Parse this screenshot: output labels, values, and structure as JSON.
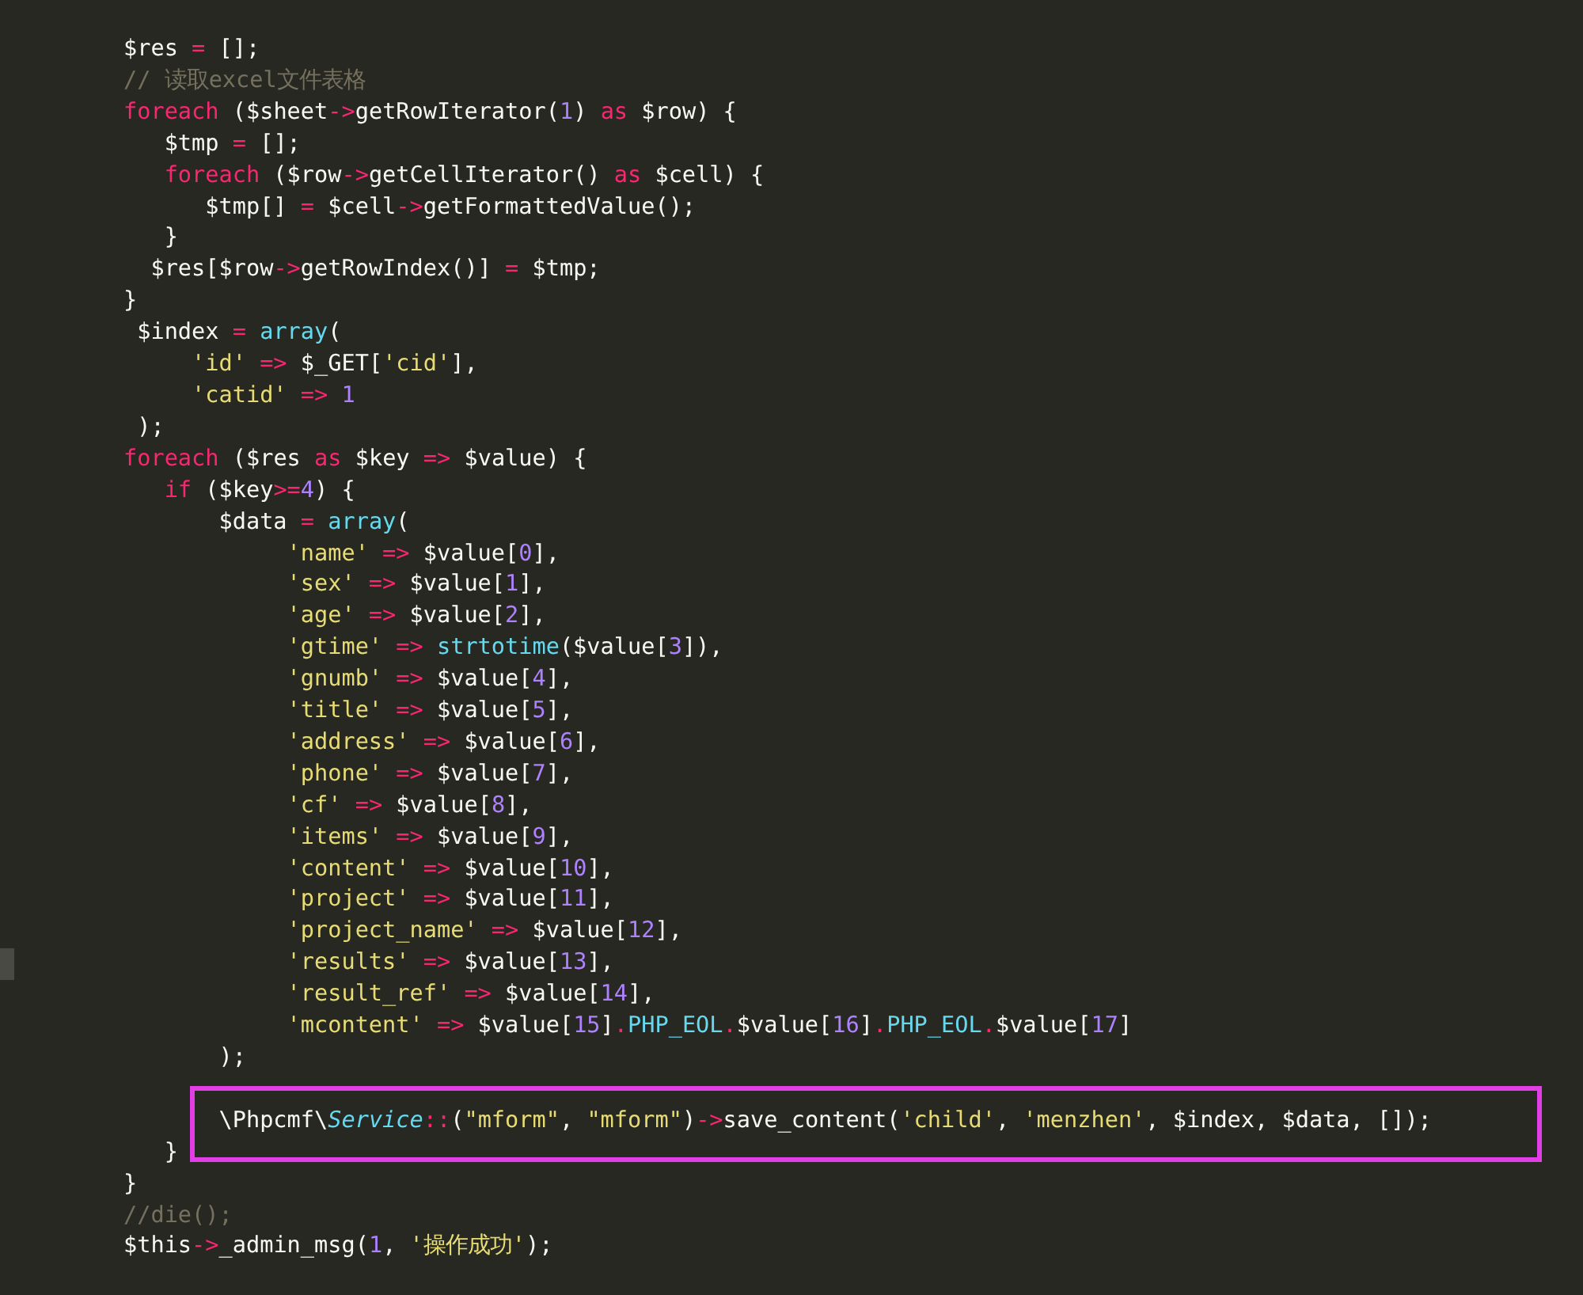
{
  "lines": [
    {
      "kind": "code",
      "tokens": [
        {
          "kind": "plain",
          "text": "$res "
        },
        {
          "kind": "keyword",
          "text": "="
        },
        {
          "kind": "plain",
          "text": " [];"
        }
      ]
    },
    {
      "kind": "code",
      "tokens": [
        {
          "kind": "comment",
          "text": "// 读取excel文件表格"
        }
      ]
    },
    {
      "kind": "code",
      "tokens": [
        {
          "kind": "keyword",
          "text": "foreach"
        },
        {
          "kind": "plain",
          "text": " ($sheet"
        },
        {
          "kind": "keyword",
          "text": "->"
        },
        {
          "kind": "plain",
          "text": "getRowIterator("
        },
        {
          "kind": "number",
          "text": "1"
        },
        {
          "kind": "plain",
          "text": ") "
        },
        {
          "kind": "keyword",
          "text": "as"
        },
        {
          "kind": "plain",
          "text": " $row) {"
        }
      ]
    },
    {
      "kind": "code",
      "tokens": [
        {
          "kind": "plain",
          "text": "   $tmp "
        },
        {
          "kind": "keyword",
          "text": "="
        },
        {
          "kind": "plain",
          "text": " [];"
        }
      ]
    },
    {
      "kind": "code",
      "tokens": [
        {
          "kind": "keyword",
          "text": "   foreach"
        },
        {
          "kind": "plain",
          "text": " ($row"
        },
        {
          "kind": "keyword",
          "text": "->"
        },
        {
          "kind": "plain",
          "text": "getCellIterator() "
        },
        {
          "kind": "keyword",
          "text": "as"
        },
        {
          "kind": "plain",
          "text": " $cell) {"
        }
      ]
    },
    {
      "kind": "code",
      "tokens": [
        {
          "kind": "plain",
          "text": "      $tmp[] "
        },
        {
          "kind": "keyword",
          "text": "="
        },
        {
          "kind": "plain",
          "text": " $cell"
        },
        {
          "kind": "keyword",
          "text": "->"
        },
        {
          "kind": "plain",
          "text": "getFormattedValue();"
        }
      ]
    },
    {
      "kind": "code",
      "tokens": [
        {
          "kind": "plain",
          "text": "   }"
        }
      ]
    },
    {
      "kind": "code",
      "tokens": [
        {
          "kind": "plain",
          "text": "  $res[$row"
        },
        {
          "kind": "keyword",
          "text": "->"
        },
        {
          "kind": "plain",
          "text": "getRowIndex()] "
        },
        {
          "kind": "keyword",
          "text": "="
        },
        {
          "kind": "plain",
          "text": " $tmp;"
        }
      ]
    },
    {
      "kind": "code",
      "tokens": [
        {
          "kind": "plain",
          "text": "}"
        }
      ]
    },
    {
      "kind": "code",
      "tokens": [
        {
          "kind": "plain",
          "text": " $index "
        },
        {
          "kind": "keyword",
          "text": "="
        },
        {
          "kind": "builtin",
          "text": " array"
        },
        {
          "kind": "plain",
          "text": "("
        }
      ]
    },
    {
      "kind": "code",
      "tokens": [
        {
          "kind": "string",
          "text": "     'id'"
        },
        {
          "kind": "keyword",
          "text": " =>"
        },
        {
          "kind": "plain",
          "text": " $_GET["
        },
        {
          "kind": "string",
          "text": "'cid'"
        },
        {
          "kind": "plain",
          "text": "],"
        }
      ]
    },
    {
      "kind": "code",
      "tokens": [
        {
          "kind": "string",
          "text": "     'catid'"
        },
        {
          "kind": "keyword",
          "text": " =>"
        },
        {
          "kind": "number",
          "text": " 1"
        }
      ]
    },
    {
      "kind": "code",
      "tokens": [
        {
          "kind": "plain",
          "text": " );"
        }
      ]
    },
    {
      "kind": "code",
      "tokens": [
        {
          "kind": "keyword",
          "text": "foreach"
        },
        {
          "kind": "plain",
          "text": " ($res "
        },
        {
          "kind": "keyword",
          "text": "as"
        },
        {
          "kind": "plain",
          "text": " $key "
        },
        {
          "kind": "keyword",
          "text": "=>"
        },
        {
          "kind": "plain",
          "text": " $value) {"
        }
      ]
    },
    {
      "kind": "code",
      "tokens": [
        {
          "kind": "keyword",
          "text": "   if"
        },
        {
          "kind": "plain",
          "text": " ($key"
        },
        {
          "kind": "keyword",
          "text": ">="
        },
        {
          "kind": "number",
          "text": "4"
        },
        {
          "kind": "plain",
          "text": ") {"
        }
      ]
    },
    {
      "kind": "code",
      "tokens": [
        {
          "kind": "plain",
          "text": "       $data "
        },
        {
          "kind": "keyword",
          "text": "="
        },
        {
          "kind": "builtin",
          "text": " array"
        },
        {
          "kind": "plain",
          "text": "("
        }
      ]
    },
    {
      "kind": "code",
      "tokens": [
        {
          "kind": "string",
          "text": "            'name'"
        },
        {
          "kind": "keyword",
          "text": " =>"
        },
        {
          "kind": "plain",
          "text": " $value["
        },
        {
          "kind": "number",
          "text": "0"
        },
        {
          "kind": "plain",
          "text": "],"
        }
      ]
    },
    {
      "kind": "code",
      "tokens": [
        {
          "kind": "string",
          "text": "            'sex'"
        },
        {
          "kind": "keyword",
          "text": " =>"
        },
        {
          "kind": "plain",
          "text": " $value["
        },
        {
          "kind": "number",
          "text": "1"
        },
        {
          "kind": "plain",
          "text": "],"
        }
      ]
    },
    {
      "kind": "code",
      "tokens": [
        {
          "kind": "string",
          "text": "            'age'"
        },
        {
          "kind": "keyword",
          "text": " =>"
        },
        {
          "kind": "plain",
          "text": " $value["
        },
        {
          "kind": "number",
          "text": "2"
        },
        {
          "kind": "plain",
          "text": "],"
        }
      ]
    },
    {
      "kind": "code",
      "tokens": [
        {
          "kind": "string",
          "text": "            'gtime'"
        },
        {
          "kind": "keyword",
          "text": " =>"
        },
        {
          "kind": "builtin",
          "text": " strtotime"
        },
        {
          "kind": "plain",
          "text": "($value["
        },
        {
          "kind": "number",
          "text": "3"
        },
        {
          "kind": "plain",
          "text": "]),"
        }
      ]
    },
    {
      "kind": "code",
      "tokens": [
        {
          "kind": "string",
          "text": "            'gnumb'"
        },
        {
          "kind": "keyword",
          "text": " =>"
        },
        {
          "kind": "plain",
          "text": " $value["
        },
        {
          "kind": "number",
          "text": "4"
        },
        {
          "kind": "plain",
          "text": "],"
        }
      ]
    },
    {
      "kind": "code",
      "tokens": [
        {
          "kind": "string",
          "text": "            'title'"
        },
        {
          "kind": "keyword",
          "text": " =>"
        },
        {
          "kind": "plain",
          "text": " $value["
        },
        {
          "kind": "number",
          "text": "5"
        },
        {
          "kind": "plain",
          "text": "],"
        }
      ]
    },
    {
      "kind": "code",
      "tokens": [
        {
          "kind": "string",
          "text": "            'address'"
        },
        {
          "kind": "keyword",
          "text": " =>"
        },
        {
          "kind": "plain",
          "text": " $value["
        },
        {
          "kind": "number",
          "text": "6"
        },
        {
          "kind": "plain",
          "text": "],"
        }
      ]
    },
    {
      "kind": "code",
      "tokens": [
        {
          "kind": "string",
          "text": "            'phone'"
        },
        {
          "kind": "keyword",
          "text": " =>"
        },
        {
          "kind": "plain",
          "text": " $value["
        },
        {
          "kind": "number",
          "text": "7"
        },
        {
          "kind": "plain",
          "text": "],"
        }
      ]
    },
    {
      "kind": "code",
      "tokens": [
        {
          "kind": "string",
          "text": "            'cf'"
        },
        {
          "kind": "keyword",
          "text": " =>"
        },
        {
          "kind": "plain",
          "text": " $value["
        },
        {
          "kind": "number",
          "text": "8"
        },
        {
          "kind": "plain",
          "text": "],"
        }
      ]
    },
    {
      "kind": "code",
      "tokens": [
        {
          "kind": "string",
          "text": "            'items'"
        },
        {
          "kind": "keyword",
          "text": " =>"
        },
        {
          "kind": "plain",
          "text": " $value["
        },
        {
          "kind": "number",
          "text": "9"
        },
        {
          "kind": "plain",
          "text": "],"
        }
      ]
    },
    {
      "kind": "code",
      "tokens": [
        {
          "kind": "string",
          "text": "            'content'"
        },
        {
          "kind": "keyword",
          "text": " =>"
        },
        {
          "kind": "plain",
          "text": " $value["
        },
        {
          "kind": "number",
          "text": "10"
        },
        {
          "kind": "plain",
          "text": "],"
        }
      ]
    },
    {
      "kind": "code",
      "tokens": [
        {
          "kind": "string",
          "text": "            'project'"
        },
        {
          "kind": "keyword",
          "text": " =>"
        },
        {
          "kind": "plain",
          "text": " $value["
        },
        {
          "kind": "number",
          "text": "11"
        },
        {
          "kind": "plain",
          "text": "],"
        }
      ]
    },
    {
      "kind": "code",
      "tokens": [
        {
          "kind": "string",
          "text": "            'project_name'"
        },
        {
          "kind": "keyword",
          "text": " =>"
        },
        {
          "kind": "plain",
          "text": " $value["
        },
        {
          "kind": "number",
          "text": "12"
        },
        {
          "kind": "plain",
          "text": "],"
        }
      ]
    },
    {
      "kind": "code",
      "current": true,
      "tokens": [
        {
          "kind": "string",
          "text": "            'results'"
        },
        {
          "kind": "keyword",
          "text": " =>"
        },
        {
          "kind": "plain",
          "text": " $value["
        },
        {
          "kind": "number",
          "text": "13"
        },
        {
          "kind": "plain",
          "text": "],"
        }
      ]
    },
    {
      "kind": "code",
      "tokens": [
        {
          "kind": "string",
          "text": "            'result_ref'"
        },
        {
          "kind": "keyword",
          "text": " =>"
        },
        {
          "kind": "plain",
          "text": " $value["
        },
        {
          "kind": "number",
          "text": "14"
        },
        {
          "kind": "plain",
          "text": "],"
        }
      ]
    },
    {
      "kind": "code",
      "tokens": [
        {
          "kind": "string",
          "text": "            'mcontent'"
        },
        {
          "kind": "keyword",
          "text": " =>"
        },
        {
          "kind": "plain",
          "text": " $value["
        },
        {
          "kind": "number",
          "text": "15"
        },
        {
          "kind": "plain",
          "text": "]"
        },
        {
          "kind": "keyword",
          "text": "."
        },
        {
          "kind": "builtin",
          "text": "PHP_EOL"
        },
        {
          "kind": "keyword",
          "text": "."
        },
        {
          "kind": "plain",
          "text": "$value["
        },
        {
          "kind": "number",
          "text": "16"
        },
        {
          "kind": "plain",
          "text": "]"
        },
        {
          "kind": "keyword",
          "text": "."
        },
        {
          "kind": "builtin",
          "text": "PHP_EOL"
        },
        {
          "kind": "keyword",
          "text": "."
        },
        {
          "kind": "plain",
          "text": "$value["
        },
        {
          "kind": "number",
          "text": "17"
        },
        {
          "kind": "plain",
          "text": "]"
        }
      ]
    },
    {
      "kind": "code",
      "tokens": [
        {
          "kind": "plain",
          "text": "       );"
        }
      ]
    },
    {
      "kind": "blank"
    },
    {
      "kind": "code",
      "highlighted": true,
      "tokens": [
        {
          "kind": "plain",
          "text": "       \\Phpcmf\\"
        },
        {
          "kind": "type",
          "text": "Service"
        },
        {
          "kind": "keyword",
          "text": "::"
        },
        {
          "kind": "plain",
          "text": "("
        },
        {
          "kind": "string",
          "text": "\"mform\""
        },
        {
          "kind": "plain",
          "text": ", "
        },
        {
          "kind": "string",
          "text": "\"mform\""
        },
        {
          "kind": "plain",
          "text": ")"
        },
        {
          "kind": "keyword",
          "text": "->"
        },
        {
          "kind": "plain",
          "text": "save_content("
        },
        {
          "kind": "string",
          "text": "'child'"
        },
        {
          "kind": "plain",
          "text": ", "
        },
        {
          "kind": "string",
          "text": "'menzhen'"
        },
        {
          "kind": "plain",
          "text": ", $index, $data, []);"
        }
      ]
    },
    {
      "kind": "code",
      "tokens": [
        {
          "kind": "plain",
          "text": "   }"
        }
      ]
    },
    {
      "kind": "code",
      "tokens": [
        {
          "kind": "plain",
          "text": "}"
        }
      ]
    },
    {
      "kind": "code",
      "tokens": [
        {
          "kind": "comment",
          "text": "//die();"
        }
      ]
    },
    {
      "kind": "code",
      "tokens": [
        {
          "kind": "plain",
          "text": "$this"
        },
        {
          "kind": "keyword",
          "text": "->"
        },
        {
          "kind": "plain",
          "text": "_admin_msg("
        },
        {
          "kind": "number",
          "text": "1"
        },
        {
          "kind": "plain",
          "text": ", "
        },
        {
          "kind": "string",
          "text": "'操作成功'"
        },
        {
          "kind": "plain",
          "text": ");"
        }
      ]
    }
  ]
}
